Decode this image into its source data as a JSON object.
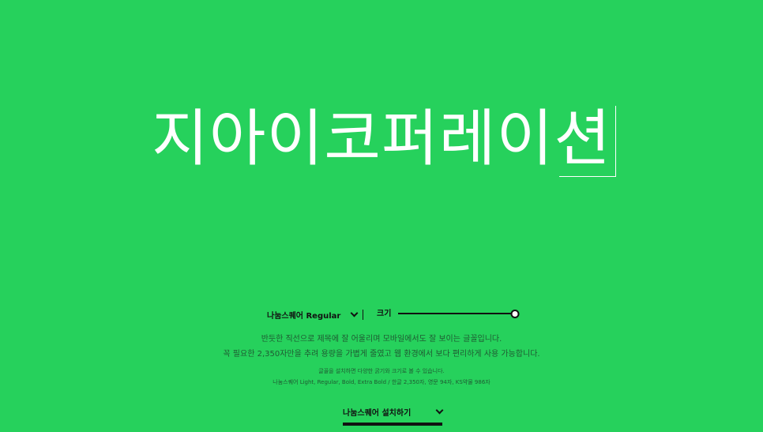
{
  "hero": {
    "text": "지아이코퍼레이션"
  },
  "controls": {
    "font_select_label": "나눔스퀘어 Regular",
    "size_label": "크기",
    "size_slider_value": 1.0
  },
  "description": {
    "line1": "반듯한 직선으로 제목에 잘 어울리며 모바일에서도 잘 보이는 글꼴입니다.",
    "line2": "꼭 필요한 2,350자만을 추려 용량을 가볍게 줄였고 웹 환경에서 보다 편리하게 사용 가능합니다.",
    "small1": "글꼴을 설치하면 다양한 굵기와 크기로 볼 수 있습니다.",
    "small2": "나눔스퀘어 Light, Regular, Bold, Extra Bold / 한글 2,350자, 영문 94자, KS약물 986자"
  },
  "install": {
    "label": "나눔스퀘어 설치하기"
  },
  "colors": {
    "background": "#26d15c",
    "text_dark": "#111111",
    "text_muted": "#1f5a32"
  },
  "icons": {
    "font_select": "chevron-down-icon",
    "install": "chevron-down-icon"
  }
}
